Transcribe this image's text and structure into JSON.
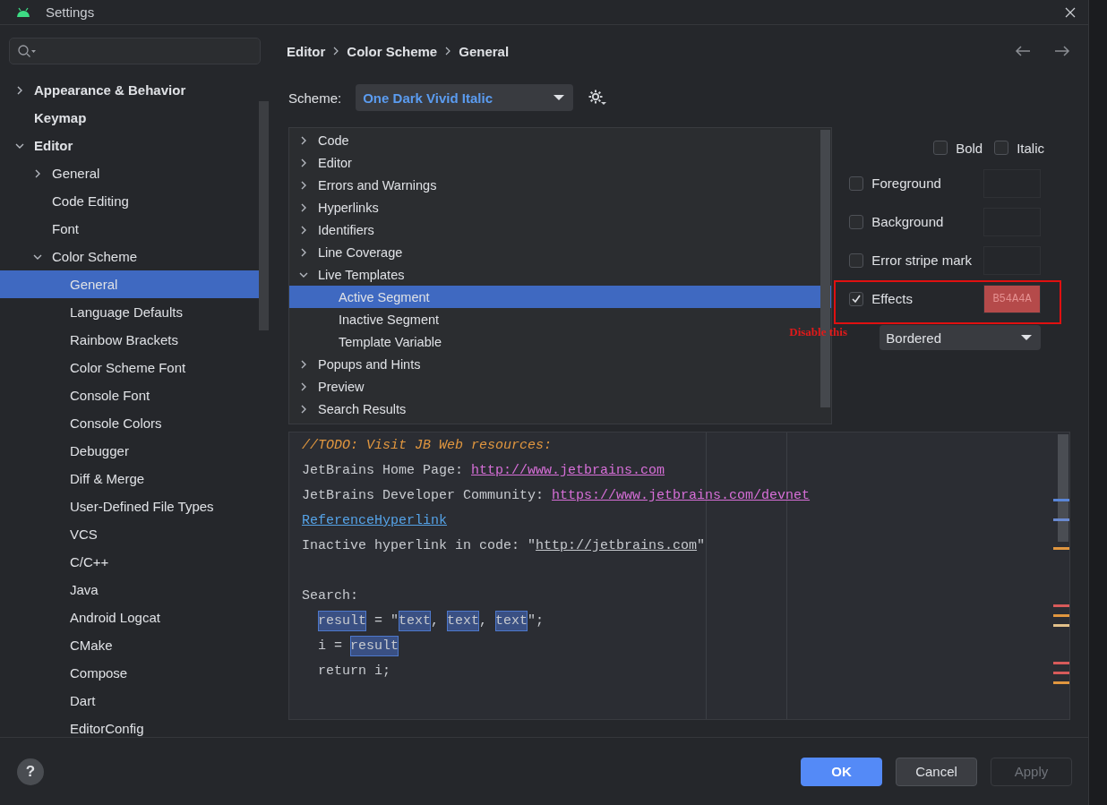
{
  "window": {
    "title": "Settings"
  },
  "sidebar": {
    "items": [
      {
        "label": "Appearance & Behavior",
        "kind": "group",
        "expanded": false,
        "selected": false
      },
      {
        "label": "Keymap",
        "kind": "page",
        "selected": false
      },
      {
        "label": "Editor",
        "kind": "group",
        "expanded": true,
        "selected": false,
        "children": [
          {
            "label": "General",
            "kind": "group",
            "expanded": false,
            "selected": false
          },
          {
            "label": "Code Editing",
            "kind": "page",
            "selected": false
          },
          {
            "label": "Font",
            "kind": "page",
            "selected": false
          },
          {
            "label": "Color Scheme",
            "kind": "group",
            "expanded": true,
            "selected": false,
            "children": [
              {
                "label": "General",
                "kind": "page",
                "selected": true
              },
              {
                "label": "Language Defaults",
                "kind": "page",
                "selected": false
              },
              {
                "label": "Rainbow Brackets",
                "kind": "page",
                "selected": false
              },
              {
                "label": "Color Scheme Font",
                "kind": "page",
                "selected": false
              },
              {
                "label": "Console Font",
                "kind": "page",
                "selected": false
              },
              {
                "label": "Console Colors",
                "kind": "page",
                "selected": false
              },
              {
                "label": "Debugger",
                "kind": "page",
                "selected": false
              },
              {
                "label": "Diff & Merge",
                "kind": "page",
                "selected": false
              },
              {
                "label": "User-Defined File Types",
                "kind": "page",
                "selected": false
              },
              {
                "label": "VCS",
                "kind": "page",
                "selected": false
              },
              {
                "label": "C/C++",
                "kind": "page",
                "selected": false
              },
              {
                "label": "Java",
                "kind": "page",
                "selected": false
              },
              {
                "label": "Android Logcat",
                "kind": "page",
                "selected": false
              },
              {
                "label": "CMake",
                "kind": "page",
                "selected": false
              },
              {
                "label": "Compose",
                "kind": "page",
                "selected": false
              },
              {
                "label": "Dart",
                "kind": "page",
                "selected": false
              },
              {
                "label": "EditorConfig",
                "kind": "page",
                "selected": false
              }
            ]
          }
        ]
      }
    ]
  },
  "breadcrumb": [
    "Editor",
    "Color Scheme",
    "General"
  ],
  "scheme": {
    "label": "Scheme:",
    "value": "One Dark Vivid Italic"
  },
  "scheme_tree": {
    "items": [
      {
        "label": "Code",
        "kind": "group",
        "expanded": false,
        "selected": false
      },
      {
        "label": "Editor",
        "kind": "group",
        "expanded": false,
        "selected": false
      },
      {
        "label": "Errors and Warnings",
        "kind": "group",
        "expanded": false,
        "selected": false
      },
      {
        "label": "Hyperlinks",
        "kind": "group",
        "expanded": false,
        "selected": false
      },
      {
        "label": "Identifiers",
        "kind": "group",
        "expanded": false,
        "selected": false
      },
      {
        "label": "Line Coverage",
        "kind": "group",
        "expanded": false,
        "selected": false
      },
      {
        "label": "Live Templates",
        "kind": "group",
        "expanded": true,
        "selected": false,
        "children": [
          {
            "label": "Active Segment",
            "kind": "page",
            "selected": true
          },
          {
            "label": "Inactive Segment",
            "kind": "page",
            "selected": false
          },
          {
            "label": "Template Variable",
            "kind": "page",
            "selected": false
          }
        ]
      },
      {
        "label": "Popups and Hints",
        "kind": "group",
        "expanded": false,
        "selected": false
      },
      {
        "label": "Preview",
        "kind": "group",
        "expanded": false,
        "selected": false
      },
      {
        "label": "Search Results",
        "kind": "group",
        "expanded": false,
        "selected": false
      }
    ]
  },
  "font_styles": [
    {
      "label": "Bold",
      "checked": false
    },
    {
      "label": "Italic",
      "checked": false
    }
  ],
  "attributes": [
    {
      "label": "Foreground",
      "checked": false,
      "highlighted": false
    },
    {
      "label": "Background",
      "checked": false,
      "highlighted": false
    },
    {
      "label": "Error stripe mark",
      "checked": false,
      "highlighted": false
    },
    {
      "label": "Effects",
      "checked": true,
      "highlighted": true,
      "color": "#b54a4a",
      "value": "B54A4A"
    }
  ],
  "effect_type": {
    "value": "Bordered"
  },
  "annotation": {
    "text": "Disable this"
  },
  "preview": {
    "lines": [
      {
        "kind": "code",
        "segments": [
          {
            "kind": "todo",
            "text": "//TODO: Visit JB Web resources:"
          }
        ]
      },
      {
        "kind": "code",
        "segments": [
          {
            "kind": "plain",
            "text": "JetBrains Home Page: "
          },
          {
            "kind": "link",
            "text": "http://www.jetbrains.com"
          }
        ]
      },
      {
        "kind": "code",
        "segments": [
          {
            "kind": "plain",
            "text": "JetBrains Developer Community: "
          },
          {
            "kind": "link",
            "text": "https://www.jetbrains.com/devnet"
          }
        ]
      },
      {
        "kind": "code",
        "segments": [
          {
            "kind": "reference",
            "text": "ReferenceHyperlink"
          }
        ]
      },
      {
        "kind": "code",
        "segments": [
          {
            "kind": "plain",
            "text": "Inactive hyperlink in code: \""
          },
          {
            "kind": "inactive_link",
            "text": "http://jetbrains.com"
          },
          {
            "kind": "plain",
            "text": "\""
          }
        ]
      },
      {
        "kind": "blank"
      },
      {
        "kind": "code",
        "segments": [
          {
            "kind": "plain",
            "text": "Search:"
          }
        ]
      },
      {
        "kind": "indented",
        "segments": [
          {
            "kind": "match",
            "text": "result"
          },
          {
            "kind": "plain",
            "text": " = \""
          },
          {
            "kind": "match",
            "text": "text"
          },
          {
            "kind": "plain",
            "text": ", "
          },
          {
            "kind": "match",
            "text": "text"
          },
          {
            "kind": "plain",
            "text": ", "
          },
          {
            "kind": "match",
            "text": "text"
          },
          {
            "kind": "plain",
            "text": "\";"
          }
        ]
      },
      {
        "kind": "indented",
        "segments": [
          {
            "kind": "plain",
            "text": "i = "
          },
          {
            "kind": "match",
            "text": "result"
          }
        ]
      },
      {
        "kind": "indented",
        "segments": [
          {
            "kind": "plain",
            "text": "return i;"
          }
        ]
      }
    ]
  },
  "help_button": {
    "label": "?"
  },
  "buttons": [
    {
      "label": "OK",
      "kind": "primary",
      "disabled": false
    },
    {
      "label": "Cancel",
      "kind": "secondary",
      "disabled": false
    },
    {
      "label": "Apply",
      "kind": "secondary",
      "disabled": true
    }
  ]
}
